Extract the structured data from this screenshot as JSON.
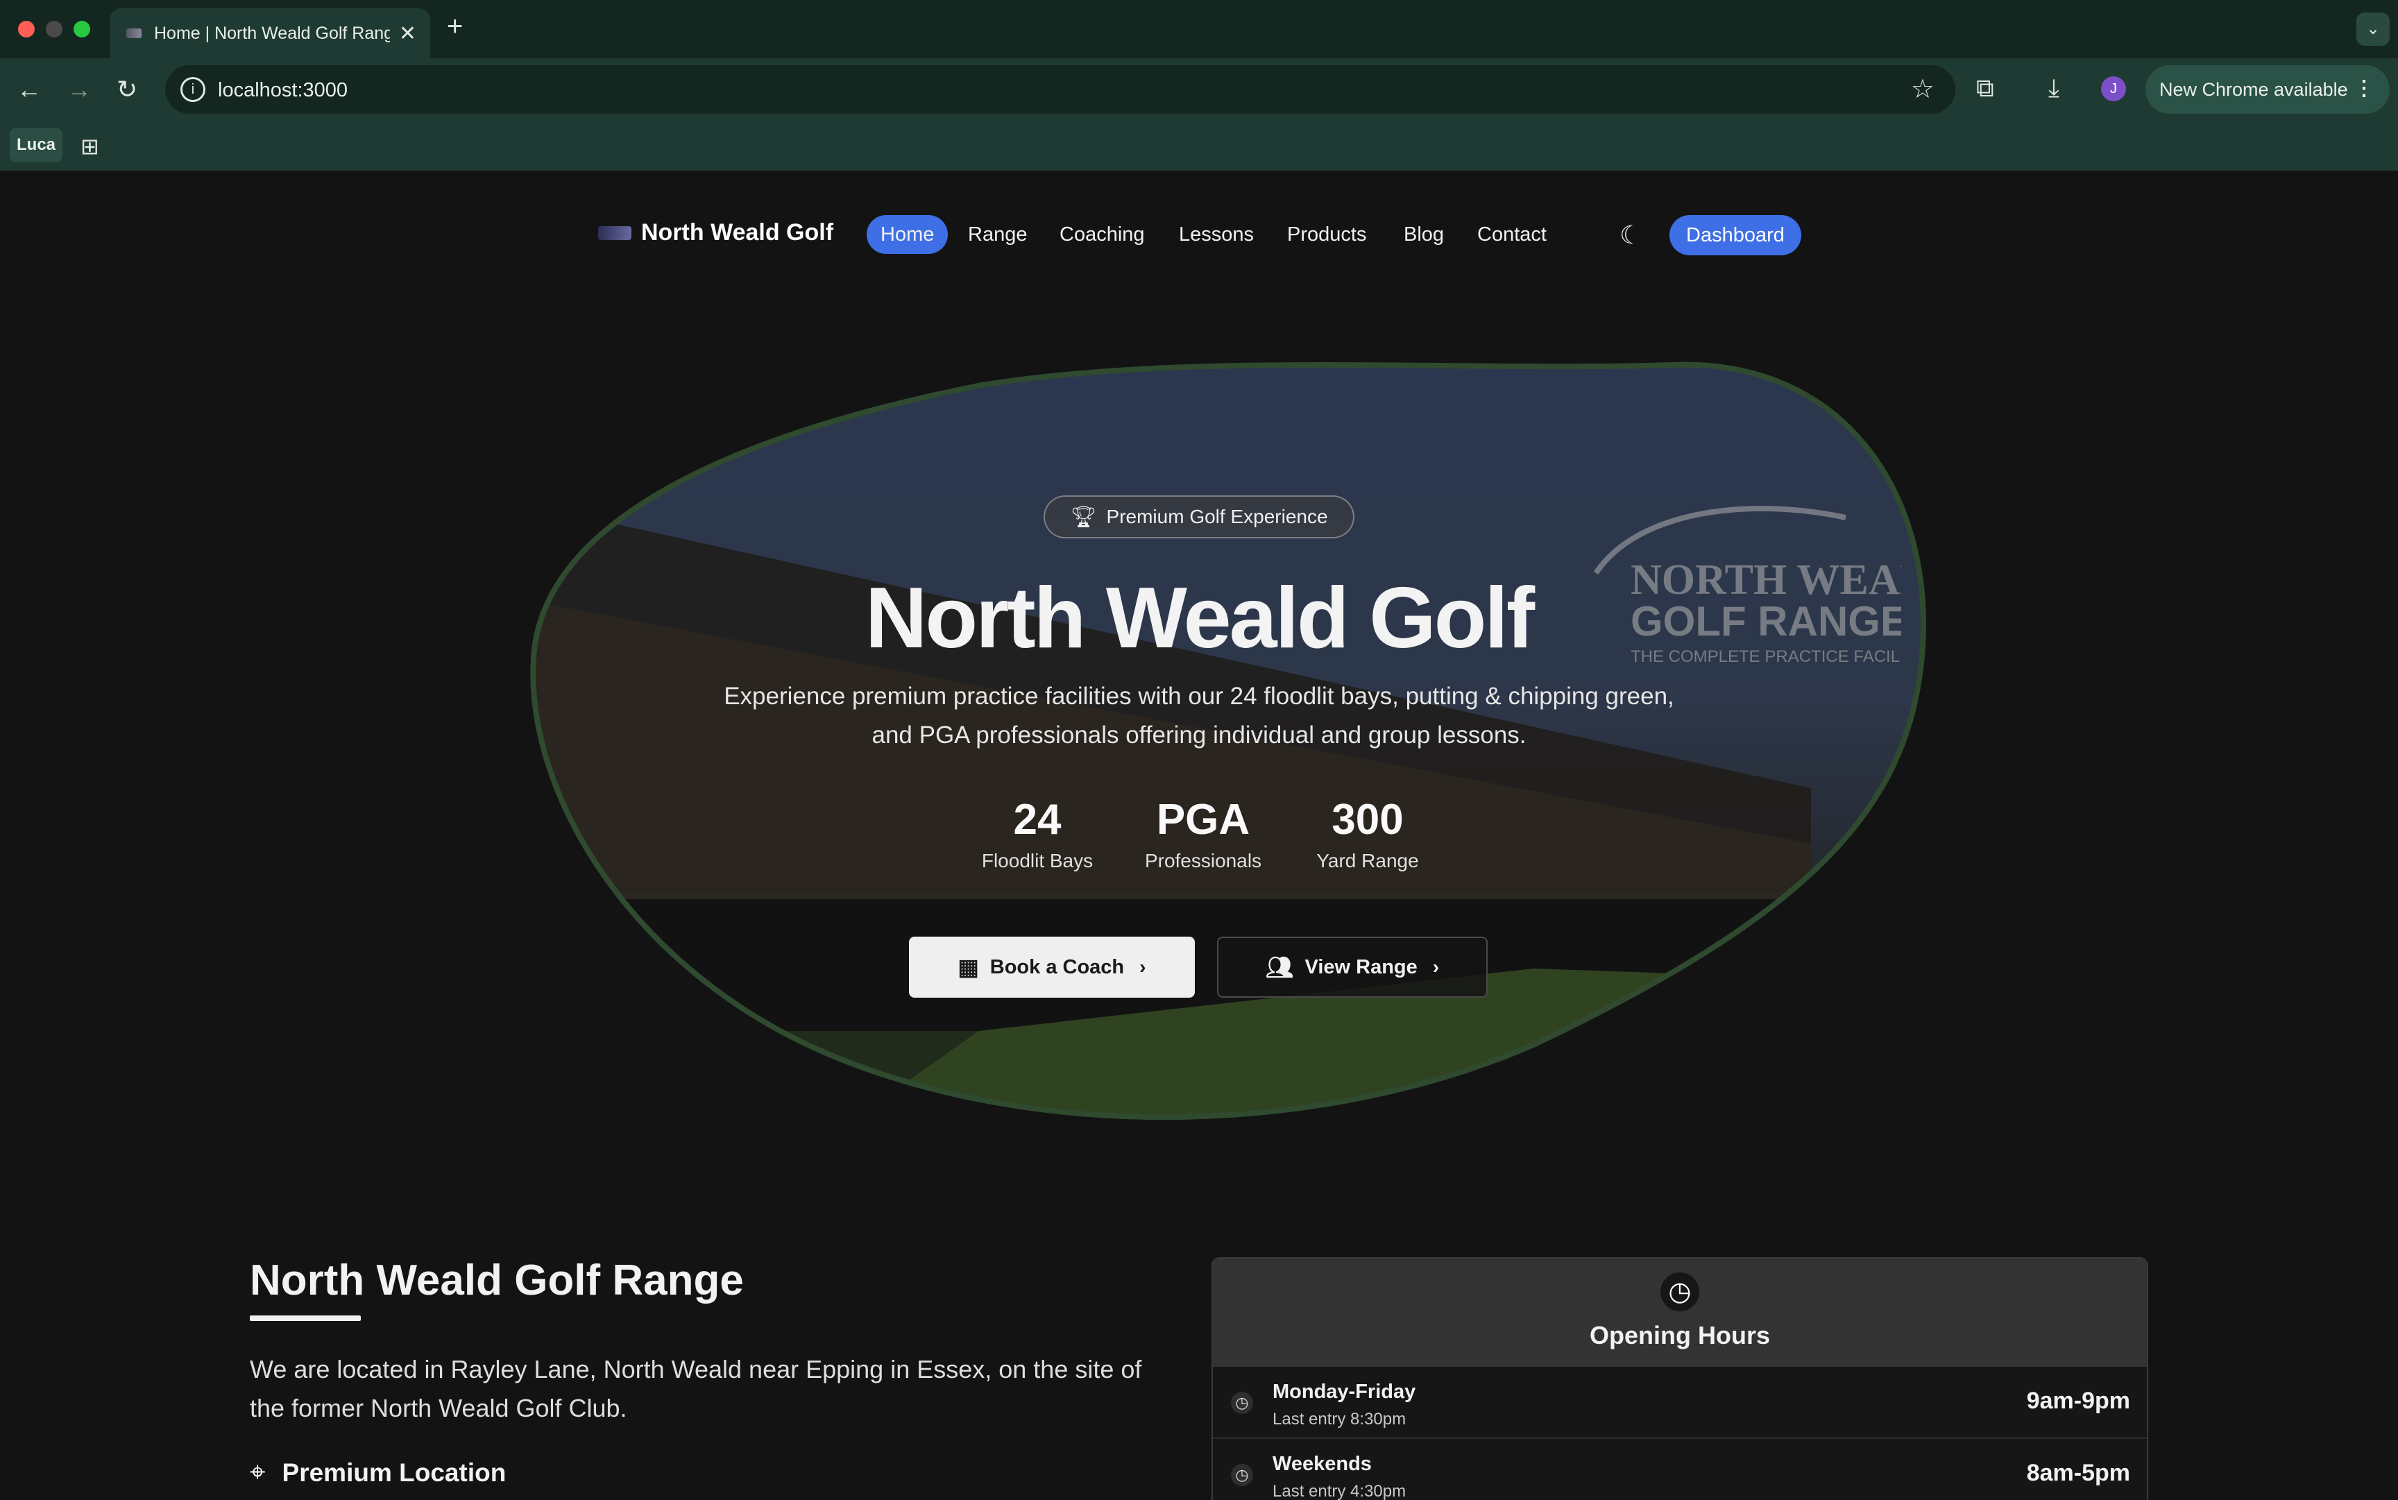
{
  "browser": {
    "tab_title": "Home | North Weald Golf Range",
    "url": "localhost:3000",
    "new_chrome_label": "New Chrome available",
    "profile_initial": "J",
    "bookmark_label": "Luca"
  },
  "nav": {
    "brand": "North Weald Golf",
    "links": [
      "Home",
      "Range",
      "Coaching",
      "Lessons",
      "Products",
      "Blog",
      "Contact"
    ],
    "active": "Home",
    "dashboard_label": "Dashboard"
  },
  "hero": {
    "badge": "Premium Golf Experience",
    "title": "North Weald Golf",
    "subtitle": "Experience premium practice facilities with our 24 floodlit bays, putting & chipping green, and PGA professionals offering individual and group lessons.",
    "stats": [
      {
        "value": "24",
        "label": "Floodlit Bays"
      },
      {
        "value": "PGA",
        "label": "Professionals"
      },
      {
        "value": "300",
        "label": "Yard Range"
      }
    ],
    "book_label": "Book a Coach",
    "view_label": "View Range",
    "watermark": {
      "line1": "NORTH WEALD",
      "line2": "GOLF RANGE",
      "line3": "THE COMPLETE PRACTICE FACILITY"
    }
  },
  "about": {
    "title": "North Weald Golf Range",
    "text": "We are located in Rayley Lane, North Weald near Epping in Essex, on the site of the former North Weald Golf Club.",
    "feature": "Premium Location"
  },
  "hours": {
    "title": "Opening Hours",
    "rows": [
      {
        "day": "Monday-Friday",
        "note": "Last entry 8:30pm",
        "time": "9am-9pm"
      },
      {
        "day": "Weekends",
        "note": "Last entry 4:30pm",
        "time": "8am-5pm"
      }
    ]
  },
  "colors": {
    "accent": "#3e6fe6",
    "background": "#131313",
    "chrome": "#1f3a32",
    "blob_border": "#2f4a2f"
  }
}
